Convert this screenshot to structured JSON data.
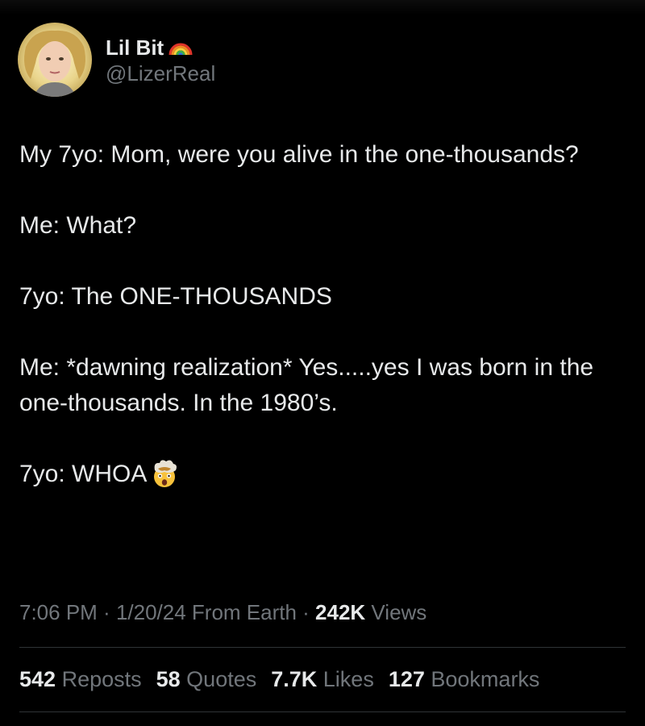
{
  "author": {
    "display_name": "Lil Bit",
    "handle": "@LizerReal",
    "badge_icon": "rainbow-icon"
  },
  "tweet": {
    "lines": [
      "My 7yo: Mom, were you alive in the one-thousands?",
      "Me: What?",
      "7yo: The ONE-THOUSANDS",
      "Me: *dawning realization* Yes.....yes I was born in the one-thousands. In the 1980’s.",
      "7yo: WHOA"
    ],
    "trailing_emoji_icon": "exploding-head-icon"
  },
  "meta": {
    "time": "7:06 PM",
    "sep1": " · ",
    "date": "1/20/24",
    "source": " From Earth",
    "sep2": " · ",
    "views_count": "242K",
    "views_label": " Views"
  },
  "stats": {
    "reposts": {
      "count": "542",
      "label": " Reposts"
    },
    "quotes": {
      "count": "58",
      "label": " Quotes"
    },
    "likes": {
      "count": "7.7K",
      "label": " Likes"
    },
    "bookmarks": {
      "count": "127",
      "label": " Bookmarks"
    }
  },
  "colors": {
    "background": "#000000",
    "primary_text": "#e7e9ea",
    "secondary_text": "#71767b",
    "divider": "#2f3336"
  }
}
